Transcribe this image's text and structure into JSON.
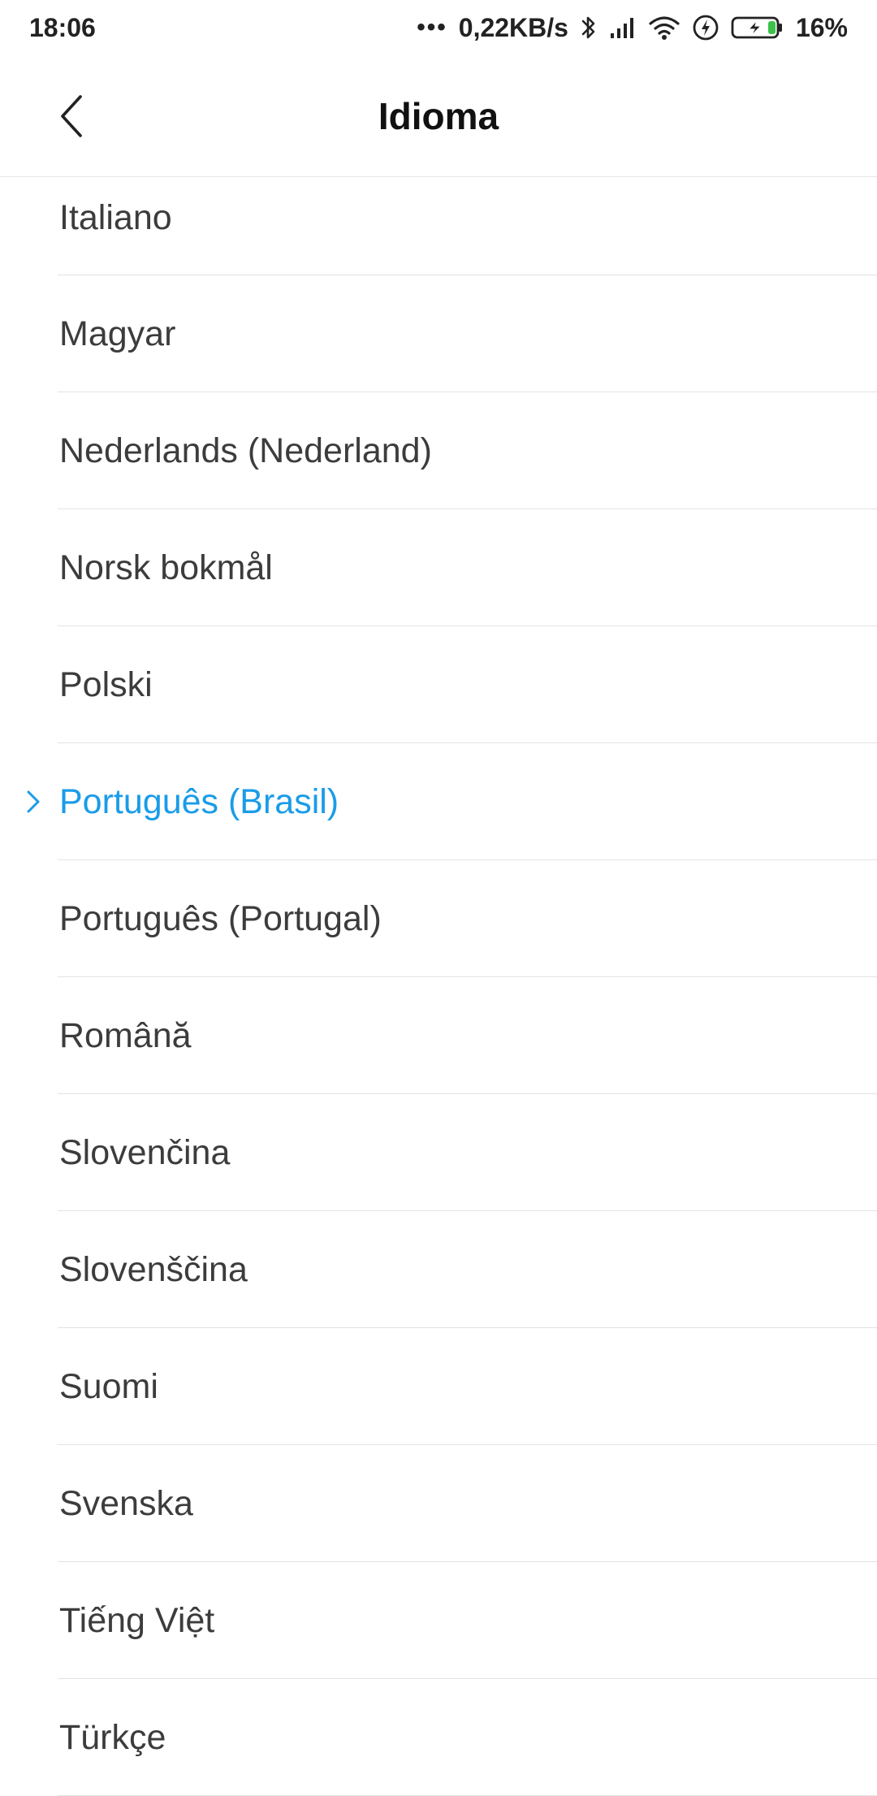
{
  "status_bar": {
    "time": "18:06",
    "more_dots": "•••",
    "network_speed": "0,22KB/s",
    "battery_percent": "16%"
  },
  "header": {
    "title": "Idioma"
  },
  "languages": [
    {
      "label": "Italiano",
      "selected": false
    },
    {
      "label": "Magyar",
      "selected": false
    },
    {
      "label": "Nederlands (Nederland)",
      "selected": false
    },
    {
      "label": "Norsk bokmål",
      "selected": false
    },
    {
      "label": "Polski",
      "selected": false
    },
    {
      "label": "Português (Brasil)",
      "selected": true
    },
    {
      "label": "Português (Portugal)",
      "selected": false
    },
    {
      "label": "Română",
      "selected": false
    },
    {
      "label": "Slovenčina",
      "selected": false
    },
    {
      "label": "Slovenščina",
      "selected": false
    },
    {
      "label": "Suomi",
      "selected": false
    },
    {
      "label": "Svenska",
      "selected": false
    },
    {
      "label": "Tiếng Việt",
      "selected": false
    },
    {
      "label": "Türkçe",
      "selected": false
    }
  ],
  "colors": {
    "accent": "#1a9ce8",
    "text": "#3c3c3c",
    "divider": "#e3e3e3",
    "battery_charge": "#3cc24a"
  },
  "icons": {
    "back": "chevron-left-icon",
    "selected_marker": "chevron-right-icon",
    "bluetooth": "bluetooth-icon",
    "signal": "signal-icon",
    "wifi": "wifi-icon",
    "charging": "flash-icon",
    "battery": "battery-icon"
  }
}
